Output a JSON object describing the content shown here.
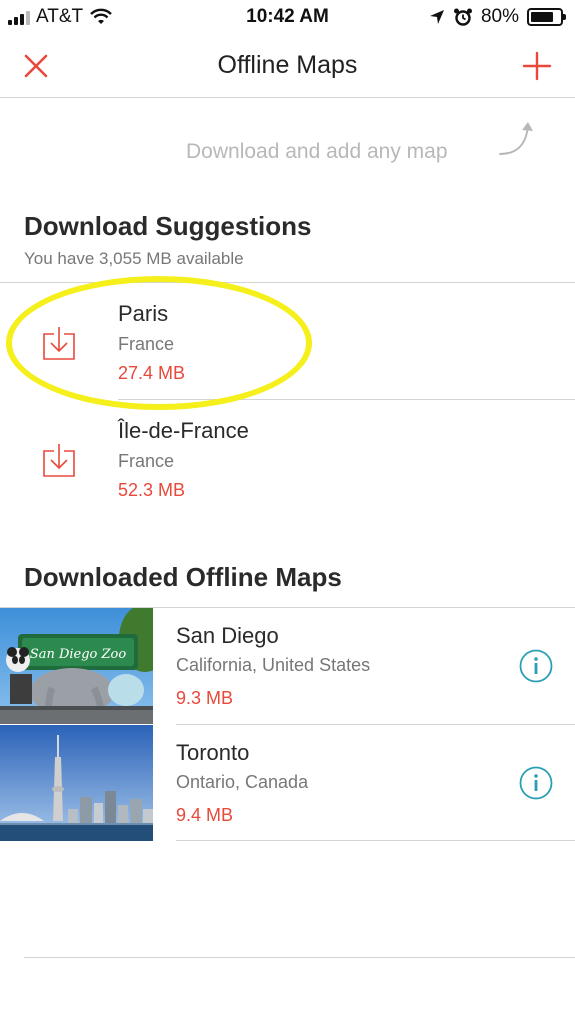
{
  "status_bar": {
    "carrier": "AT&T",
    "time": "10:42 AM",
    "battery_pct": "80%",
    "battery_level": 0.8,
    "icons": [
      "signal-icon",
      "wifi-icon",
      "location-arrow-icon",
      "alarm-icon",
      "battery-icon"
    ]
  },
  "nav": {
    "title": "Offline Maps",
    "close_icon": "close-icon",
    "add_icon": "plus-icon"
  },
  "hint": {
    "text": "Download and add any map"
  },
  "suggestions": {
    "title": "Download Suggestions",
    "subtitle": "You have 3,055 MB available",
    "items": [
      {
        "name": "Paris",
        "region": "France",
        "size": "27.4 MB",
        "icon": "download-icon"
      },
      {
        "name": "Île-de-France",
        "region": "France",
        "size": "52.3 MB",
        "icon": "download-icon"
      }
    ]
  },
  "downloaded": {
    "title": "Downloaded Offline Maps",
    "items": [
      {
        "name": "San Diego",
        "region": "California, United States",
        "size": "9.3 MB",
        "icon": "info-icon"
      },
      {
        "name": "Toronto",
        "region": "Ontario, Canada",
        "size": "9.4 MB",
        "icon": "info-icon"
      }
    ]
  },
  "colors": {
    "accent": "#e8493b",
    "info": "#2a9fb4",
    "highlight": "#f5ef1c"
  }
}
